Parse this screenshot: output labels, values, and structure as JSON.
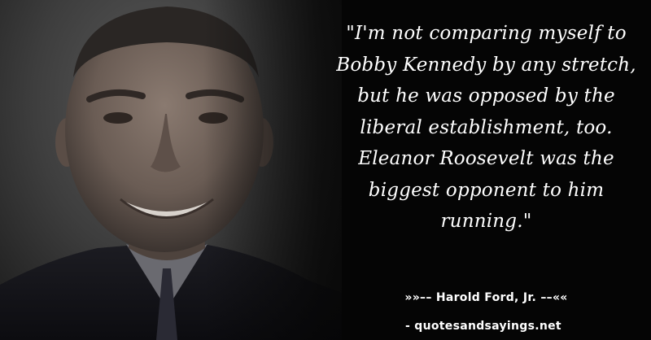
{
  "quote": {
    "text": "\"I'm not comparing myself to Bobby Kennedy by any stretch, but he was opposed by the liberal establishment, too. Eleanor Roosevelt was the biggest opponent to him running.\""
  },
  "author": {
    "line": "»»–– Harold Ford, Jr. ––««"
  },
  "footer": {
    "site": "- quotesandsayings.net"
  },
  "colors": {
    "background": "#050505",
    "text": "#ffffff"
  }
}
